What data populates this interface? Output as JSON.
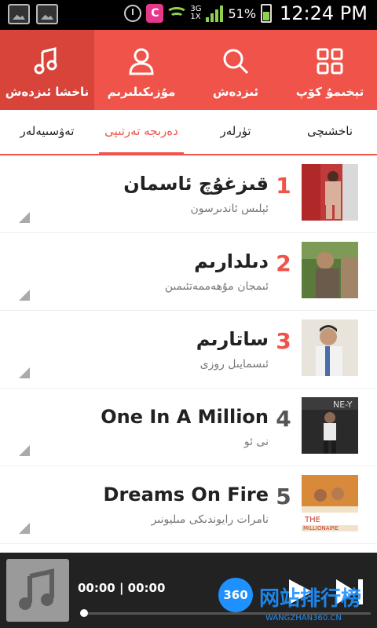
{
  "status_bar": {
    "network": "3G\n1X",
    "battery": "51%",
    "time": "12:24 PM"
  },
  "top_nav": [
    {
      "label": "ناخشا ئىزدەش",
      "icon": "music-note-icon",
      "active": true
    },
    {
      "label": "مۇزىكىلىرىم",
      "icon": "person-icon",
      "active": false
    },
    {
      "label": "ئىزدەش",
      "icon": "search-icon",
      "active": false
    },
    {
      "label": "تېخىمۇ كۆپ",
      "icon": "grid-icon",
      "active": false
    }
  ],
  "sub_tabs": [
    {
      "label": "تەۋسىيەلەر",
      "active": false
    },
    {
      "label": "دەرىجە تەرتىپى",
      "active": true
    },
    {
      "label": "تۈرلەر",
      "active": false
    },
    {
      "label": "ناخشىچى",
      "active": false
    }
  ],
  "songs": [
    {
      "rank": "1",
      "title": "قىزغۇچ ئاسمان",
      "artist": "ئېلىس ئاندىرسون"
    },
    {
      "rank": "2",
      "title": "دىلدارىم",
      "artist": "ئىمجان مۇھەممەتئىمىن"
    },
    {
      "rank": "3",
      "title": "ساتارىم",
      "artist": "ئىسمايىل روزى"
    },
    {
      "rank": "4",
      "title": "One In A Million",
      "artist": "نى ئو"
    },
    {
      "rank": "5",
      "title": "Dreams On Fire",
      "artist": "نامرات رايوندىكى مىليونىر"
    }
  ],
  "player": {
    "time": "00:00 | 00:00",
    "progress": 0
  },
  "watermark": {
    "badge": "360",
    "text": "网站排行榜",
    "url": "WANGZHAN360.CN"
  },
  "colors": {
    "accent": "#ef5349",
    "accent_dark": "#d8433a",
    "player_bg": "#222222"
  }
}
